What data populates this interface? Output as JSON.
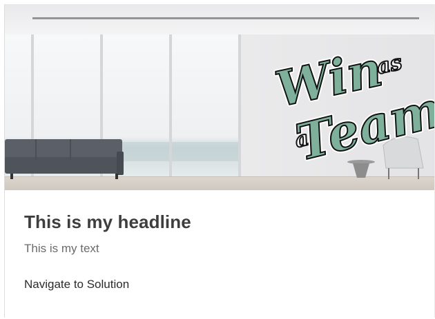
{
  "card": {
    "headline": "This is my headline",
    "text": "This is my text",
    "link_label": "Navigate to Solution"
  },
  "hero": {
    "artwork_lettering": "Win as a Team",
    "artwork_color": "#7fb09b"
  }
}
